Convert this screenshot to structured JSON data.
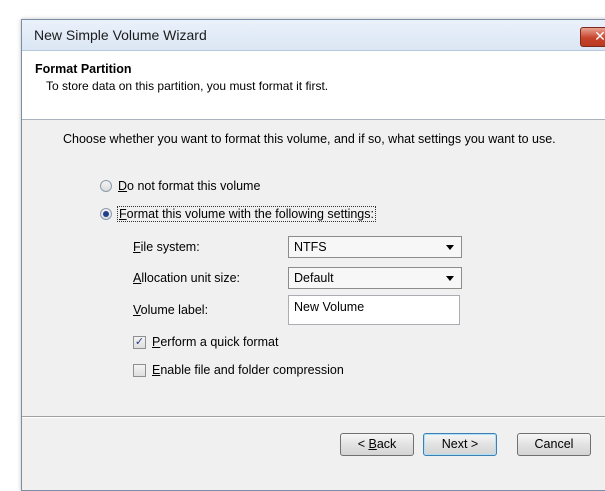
{
  "window": {
    "title": "New Simple Volume Wizard",
    "close_glyph": "✕"
  },
  "header": {
    "title": "Format Partition",
    "description": "To store data on this partition, you must format it first."
  },
  "prompt": "Choose whether you want to format this volume, and if so, what settings you want to use.",
  "options": {
    "no_format": {
      "accel": "D",
      "rest": "o not format this volume",
      "selected": false
    },
    "format": {
      "accel": "F",
      "rest": "ormat this volume with the following settings:",
      "selected": true
    }
  },
  "fields": {
    "file_system": {
      "accel": "F",
      "rest": "ile system:",
      "value": "NTFS"
    },
    "allocation_unit": {
      "accel": "A",
      "rest": "llocation unit size:",
      "value": "Default"
    },
    "volume_label": {
      "accel": "V",
      "rest": "olume label:",
      "value": "New Volume"
    }
  },
  "checkboxes": {
    "quick_format": {
      "accel": "P",
      "rest": "erform a quick format",
      "checked": true,
      "check_glyph": "✓"
    },
    "compression": {
      "accel": "E",
      "rest": "nable file and folder compression",
      "checked": false
    }
  },
  "buttons": {
    "back": {
      "prefix": "< ",
      "accel": "B",
      "rest": "ack"
    },
    "next": "Next >",
    "cancel": "Cancel"
  }
}
